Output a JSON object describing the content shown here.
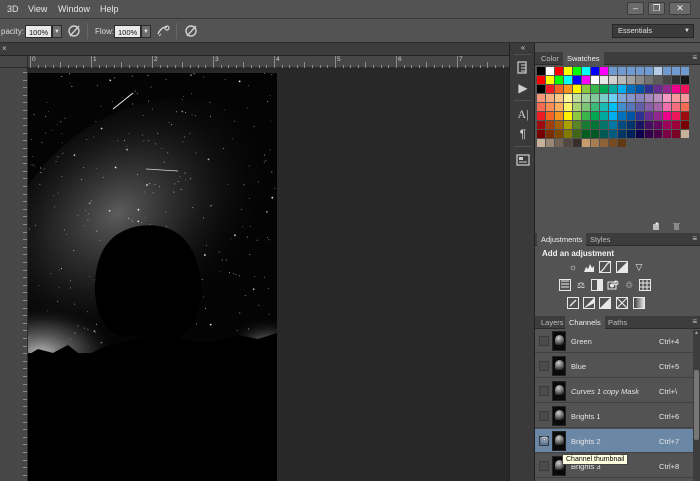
{
  "menubar": {
    "items": [
      "3D",
      "View",
      "Window",
      "Help"
    ],
    "window_buttons": [
      "–",
      "❐",
      "✕"
    ]
  },
  "options_bar": {
    "opacity_label": "pacity:",
    "opacity_value": "100%",
    "flow_label": "Flow:",
    "flow_value": "100%",
    "workspace": "Essentials"
  },
  "document_tab": {
    "close": "×"
  },
  "ruler": {
    "top_numbers": [
      "0",
      "1",
      "2",
      "3",
      "4",
      "5",
      "6",
      "7",
      "8"
    ]
  },
  "swatches_panel": {
    "tabs": [
      "Color",
      "Swatches"
    ],
    "active_tab": "Swatches",
    "rows": [
      [
        "#000000",
        "#ffffff",
        "#ff0000",
        "#ffff00",
        "#00ff00",
        "#00ffff",
        "#0000ff",
        "#ff00ff",
        "#6f9bd2",
        "#6f9bd2",
        "#6f9bd2",
        "#6f9bd2",
        "#6f9bd2",
        "#b6cbe9",
        "#6f9bd2",
        "#6f9bd2",
        "#6f9bd2"
      ],
      [
        "#ff0000",
        "#ffff00",
        "#00ff00",
        "#00ffff",
        "#0000ff",
        "#ff00ff",
        "#ffffff",
        "#e8e8e8",
        "#d1d1d1",
        "#b9b9b9",
        "#a2a2a2",
        "#8a8a8a",
        "#737373",
        "#5c5c5c",
        "#454545",
        "#2e2e2e",
        "#171717"
      ],
      [
        "#000000",
        "#ed1c24",
        "#f26522",
        "#f7941d",
        "#fff200",
        "#8dc63f",
        "#39b54a",
        "#00a651",
        "#00a99d",
        "#00aeef",
        "#0072bc",
        "#0054a6",
        "#2e3192",
        "#662d91",
        "#92278f",
        "#ec008c",
        "#ed145b"
      ],
      [
        "#f7977a",
        "#f9ad81",
        "#fdc68a",
        "#fff79a",
        "#c4df9b",
        "#a3d39c",
        "#82ca9d",
        "#7bcdc8",
        "#6ecff6",
        "#7ea7d8",
        "#8493ca",
        "#8882be",
        "#a187be",
        "#bc8dbf",
        "#f49ac2",
        "#f6989d",
        "#f5989d"
      ],
      [
        "#f26c4f",
        "#f68e55",
        "#fbaf5c",
        "#fff467",
        "#acd372",
        "#7cc576",
        "#3bb878",
        "#1abbb4",
        "#00bff3",
        "#438ccb",
        "#5574b9",
        "#605ca8",
        "#855fa8",
        "#a763a8",
        "#f06ea9",
        "#f26d7d",
        "#f26c4f"
      ],
      [
        "#ed1c24",
        "#f26522",
        "#f7941d",
        "#fff200",
        "#8dc63f",
        "#39b54a",
        "#00a651",
        "#00a99d",
        "#00aeef",
        "#0072bc",
        "#0054a6",
        "#2e3192",
        "#662d91",
        "#92278f",
        "#ec008c",
        "#ed145b",
        "#9e0b0f"
      ],
      [
        "#9e0b0f",
        "#a0410d",
        "#a36209",
        "#aba000",
        "#598527",
        "#197b30",
        "#007236",
        "#00746b",
        "#0076a3",
        "#004b80",
        "#003471",
        "#1b1464",
        "#440e62",
        "#630460",
        "#9e005d",
        "#9e0039",
        "#790000"
      ],
      [
        "#790000",
        "#7b2e00",
        "#7d4900",
        "#827b00",
        "#406618",
        "#005e20",
        "#005826",
        "#005952",
        "#005b7f",
        "#003663",
        "#002157",
        "#0d004c",
        "#32004b",
        "#4b0049",
        "#7b0046",
        "#7a0026",
        "#c7b299"
      ],
      [
        "#c7b299",
        "#998675",
        "#736357",
        "#534741",
        "#37302a",
        "#c69c6d",
        "#a67c52",
        "#8c6239",
        "#754c24",
        "#603913"
      ]
    ]
  },
  "adjustments_panel": {
    "tabs": [
      "Adjustments",
      "Styles"
    ],
    "active_tab": "Adjustments",
    "title": "Add an adjustment"
  },
  "channels_panel": {
    "tabs": [
      "Layers",
      "Channels",
      "Paths"
    ],
    "active_tab": "Channels",
    "rows": [
      {
        "name": "Green",
        "shortcut": "Ctrl+4",
        "visible": false,
        "selected": false,
        "italic": false
      },
      {
        "name": "Blue",
        "shortcut": "Ctrl+5",
        "visible": false,
        "selected": false,
        "italic": false
      },
      {
        "name": "Curves 1 copy Mask",
        "shortcut": "Ctrl+\\",
        "visible": false,
        "selected": false,
        "italic": true
      },
      {
        "name": "Brights 1",
        "shortcut": "Ctrl+6",
        "visible": false,
        "selected": false,
        "italic": false
      },
      {
        "name": "Brights 2",
        "shortcut": "Ctrl+7",
        "visible": true,
        "selected": true,
        "italic": false
      },
      {
        "name": "Brights 3",
        "shortcut": "Ctrl+8",
        "visible": false,
        "selected": false,
        "italic": false
      }
    ]
  },
  "tooltip": "Channel thumbnail"
}
